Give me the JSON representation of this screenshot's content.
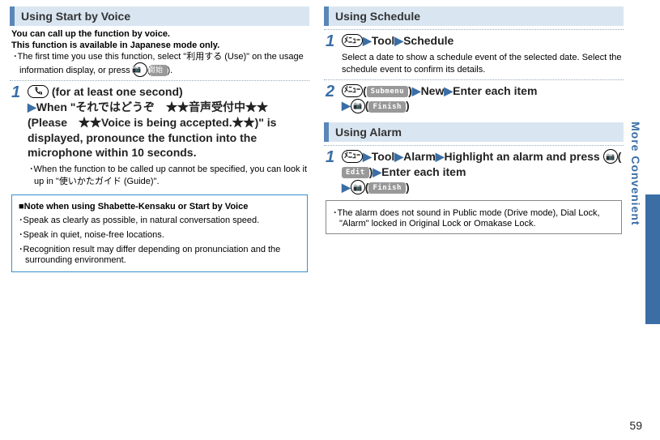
{
  "left": {
    "heading": "Using Start by Voice",
    "intro1": "You can call up the function by voice.",
    "intro2": "This function is available in Japanese mode only.",
    "bullet1": "･The ﬁrst time you use this function, select \"利用する (Use)\" on the usage information display, or press ",
    "pill_start": "開始",
    "bullet1_end": ").",
    "step1_num": "1",
    "step1_text": " (for at least one second)",
    "step1_main": "When \"それではどうぞ　★★音声受付中★★ (Please　★★Voice is being accepted.★★)\" is displayed, pronounce the function into the microphone within 10 seconds.",
    "step1_sub": "･When the function to be called up cannot be speciﬁed, you can look it up in \"使いかたガイド (Guide)\".",
    "note_title": "■Note when using Shabette-Kensaku or Start by Voice",
    "note_b1": "･Speak as clearly as possible, in natural conversation speed.",
    "note_b2": "･Speak in quiet, noise-free locations.",
    "note_b3": "･Recognition result may differ depending on pronunciation and the surrounding environment."
  },
  "right": {
    "heading_schedule": "Using Schedule",
    "sched_step1_num": "1",
    "sched_tool": "Tool",
    "sched_schedule": "Schedule",
    "sched_desc": "Select a date to show a schedule event of the selected date. Select the schedule event to conﬁrm its details.",
    "sched_step2_num": "2",
    "pill_submenu": "Submenu",
    "sched_new": "New",
    "sched_enter": "Enter each item",
    "pill_finish": "Finish",
    "heading_alarm": "Using Alarm",
    "alarm_step1_num": "1",
    "alarm_tool": "Tool",
    "alarm_alarm": "Alarm",
    "alarm_hl": "Highlight an alarm and press ",
    "pill_edit": "Edit",
    "alarm_enter": "Enter each item",
    "alarm_note": "･The alarm does not sound in Public mode (Drive mode), Dial Lock, \"Alarm\" locked in Original Lock or Omakase Lock."
  },
  "side_text": "More Convenient",
  "page_num": "59",
  "icons": {
    "camera_tv": "📷",
    "menu_jp": "ﾒﾆｭｰ"
  }
}
